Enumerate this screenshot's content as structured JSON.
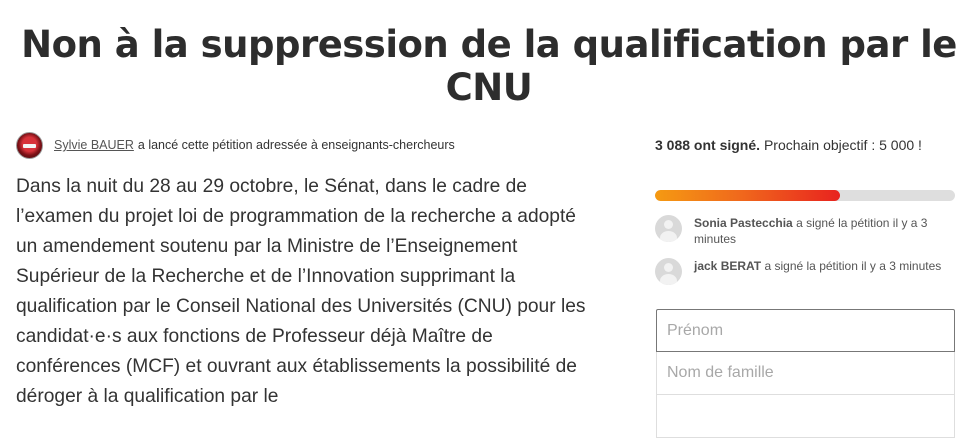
{
  "page": {
    "title": "Non à la suppression de la qualification par le CNU"
  },
  "starter": {
    "name": "Sylvie BAUER",
    "action_text": "a lancé cette pétition adressée à enseignants-chercheurs",
    "avatar_icon": "user-avatar-icon"
  },
  "body": {
    "text": "Dans la nuit du 28 au 29 octobre, le Sénat, dans le cadre de l’examen du projet loi de programmation de la recherche a adopté un amendement soutenu par la Ministre de l’Enseignement Supérieur de la Recherche et de l’Innovation supprimant la qualification par le Conseil National des Universités (CNU) pour les candidat·e·s aux fonctions de Professeur déjà Maître de conférences (MCF) et ouvrant aux établissements la possibilité de déroger à la qualification par le"
  },
  "goal": {
    "signed_count": "3 088 ont signé.",
    "next_goal_text": "Prochain objectif : 5 000 !",
    "signed": 3088,
    "target": 5000,
    "progress_fraction": 0.6176
  },
  "recent_signers": [
    {
      "name": "Sonia Pastecchia",
      "action": "a signé la pétition il y a 3 minutes"
    },
    {
      "name": "jack BERAT",
      "action": "a signé la pétition il y a 3 minutes"
    }
  ],
  "form": {
    "first_name_placeholder": "Prénom",
    "last_name_placeholder": "Nom de famille",
    "email_placeholder": ""
  },
  "colors": {
    "progress_start": "#f59a12",
    "progress_end": "#e8231f",
    "track": "#dedede"
  }
}
